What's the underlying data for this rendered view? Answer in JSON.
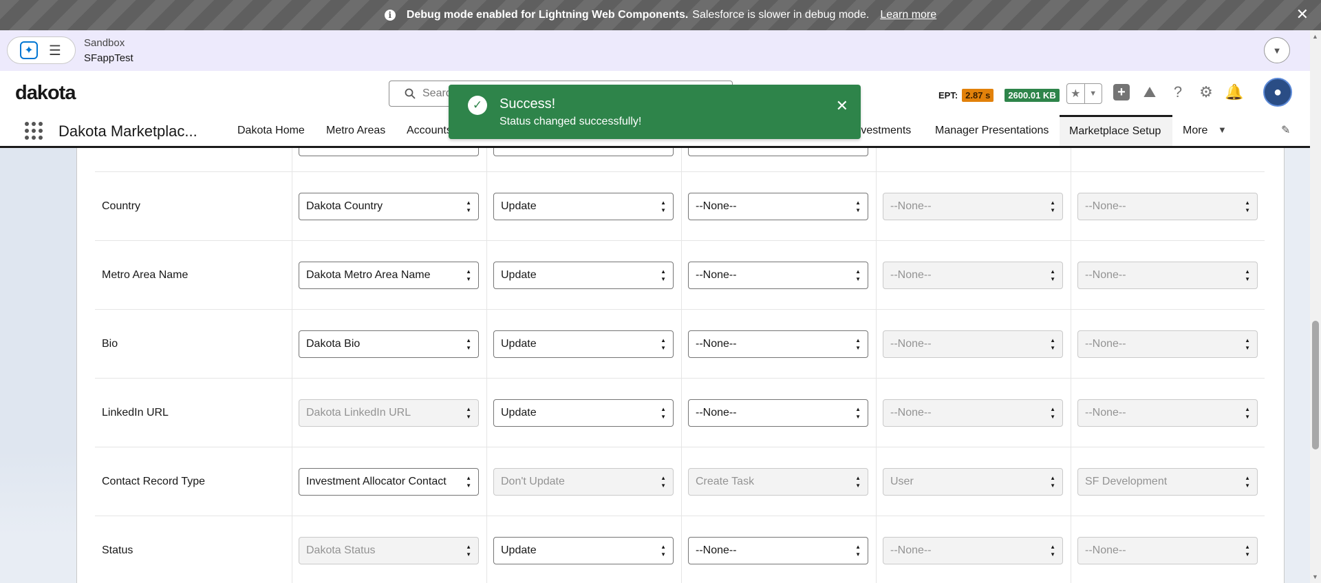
{
  "debug_banner": {
    "bold": "Debug mode enabled for Lightning Web Components.",
    "text": "Salesforce is slower in debug mode.",
    "link": "Learn more",
    "close": "✕"
  },
  "sandbox": {
    "label": "Sandbox",
    "org": "SFappTest"
  },
  "header": {
    "brand": "dakota",
    "search_placeholder": "Search...",
    "ept_label": "EPT:",
    "ept_value": "2.87 s",
    "kb_value": "2600.01 KB"
  },
  "nav": {
    "app_name": "Dakota Marketplac...",
    "items": [
      "Dakota Home",
      "Metro Areas",
      "Accounts",
      "Investments",
      "Manager Presentations",
      "Marketplace Setup",
      "More"
    ]
  },
  "toast": {
    "title": "Success!",
    "message": "Status changed successfully!"
  },
  "rows": [
    {
      "label": "Country",
      "c1": "Dakota Country",
      "c1_dis": false,
      "c2": "Update",
      "c2_dis": false,
      "c3": "--None--",
      "c3_dis": false,
      "c4": "--None--",
      "c4_dis": true,
      "c5": "--None--",
      "c5_dis": true
    },
    {
      "label": "Metro Area Name",
      "c1": "Dakota Metro Area Name",
      "c1_dis": false,
      "c2": "Update",
      "c2_dis": false,
      "c3": "--None--",
      "c3_dis": false,
      "c4": "--None--",
      "c4_dis": true,
      "c5": "--None--",
      "c5_dis": true
    },
    {
      "label": "Bio",
      "c1": "Dakota Bio",
      "c1_dis": false,
      "c2": "Update",
      "c2_dis": false,
      "c3": "--None--",
      "c3_dis": false,
      "c4": "--None--",
      "c4_dis": true,
      "c5": "--None--",
      "c5_dis": true
    },
    {
      "label": "LinkedIn URL",
      "c1": "Dakota LinkedIn URL",
      "c1_dis": true,
      "c2": "Update",
      "c2_dis": false,
      "c3": "--None--",
      "c3_dis": false,
      "c4": "--None--",
      "c4_dis": true,
      "c5": "--None--",
      "c5_dis": true
    },
    {
      "label": "Contact Record Type",
      "c1": "Investment Allocator Contact",
      "c1_dis": false,
      "c2": "Don't Update",
      "c2_dis": true,
      "c3": "Create Task",
      "c3_dis": true,
      "c4": "User",
      "c4_dis": true,
      "c5": "SF Development",
      "c5_dis": true
    },
    {
      "label": "Status",
      "c1": "Dakota Status",
      "c1_dis": true,
      "c2": "Update",
      "c2_dis": false,
      "c3": "--None--",
      "c3_dis": false,
      "c4": "--None--",
      "c4_dis": true,
      "c5": "--None--",
      "c5_dis": true
    }
  ],
  "colors": {
    "toast": "#2e844a",
    "ept_badge": "#e2810a",
    "kb_badge": "#2e844a"
  }
}
